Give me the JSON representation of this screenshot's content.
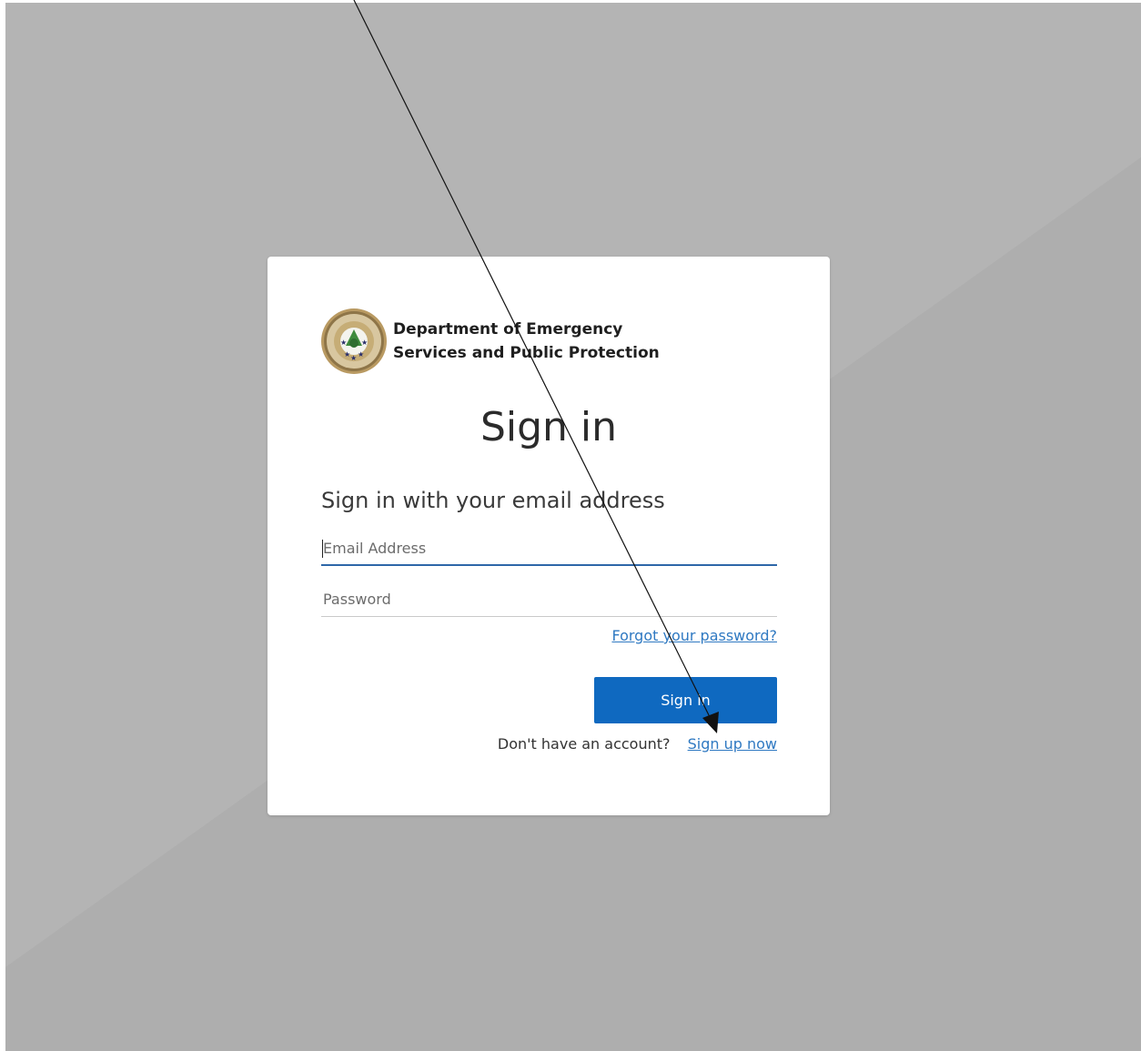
{
  "organization": {
    "name": "Department of Emergency\nServices and Public Protection",
    "seal_icon": "state-seal-icon"
  },
  "heading": "Sign in",
  "subheading": "Sign in with your email address",
  "form": {
    "email_placeholder": "Email Address",
    "password_placeholder": "Password",
    "forgot_password": "Forgot your password?",
    "submit_label": "Sign in"
  },
  "signup": {
    "prompt": "Don't have an account?",
    "link": "Sign up now"
  },
  "colors": {
    "background": "#b1b1b1",
    "primary_button": "#0f69c0",
    "link": "#2f79c2",
    "input_focus": "#2e67a8"
  }
}
